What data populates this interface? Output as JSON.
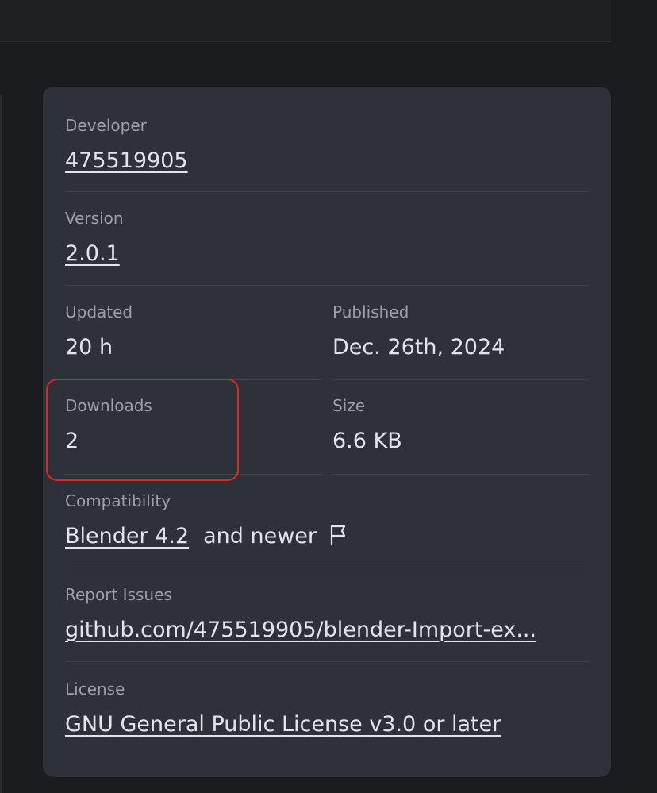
{
  "details": {
    "developer": {
      "label": "Developer",
      "value": "475519905"
    },
    "version": {
      "label": "Version",
      "value": "2.0.1"
    },
    "updated": {
      "label": "Updated",
      "value": "20 h"
    },
    "published": {
      "label": "Published",
      "value": "Dec. 26th, 2024"
    },
    "downloads": {
      "label": "Downloads",
      "value": "2"
    },
    "size": {
      "label": "Size",
      "value": "6.6 KB"
    },
    "compatibility": {
      "label": "Compatibility",
      "link": "Blender 4.2",
      "suffix": "and newer",
      "flag_icon": "flag-icon"
    },
    "report_issues": {
      "label": "Report Issues",
      "value": "github.com/475519905/blender-Import-ex..."
    },
    "license": {
      "label": "License",
      "value": "GNU General Public License v3.0 or later"
    }
  },
  "highlight": {
    "target": "downloads",
    "color": "#e0262b"
  },
  "colors": {
    "page_background": "#1b1c20",
    "card_background": "#2e3138",
    "label_text": "#9ba0aa",
    "value_text": "#e2e4e9",
    "divider": "#3f434b"
  }
}
